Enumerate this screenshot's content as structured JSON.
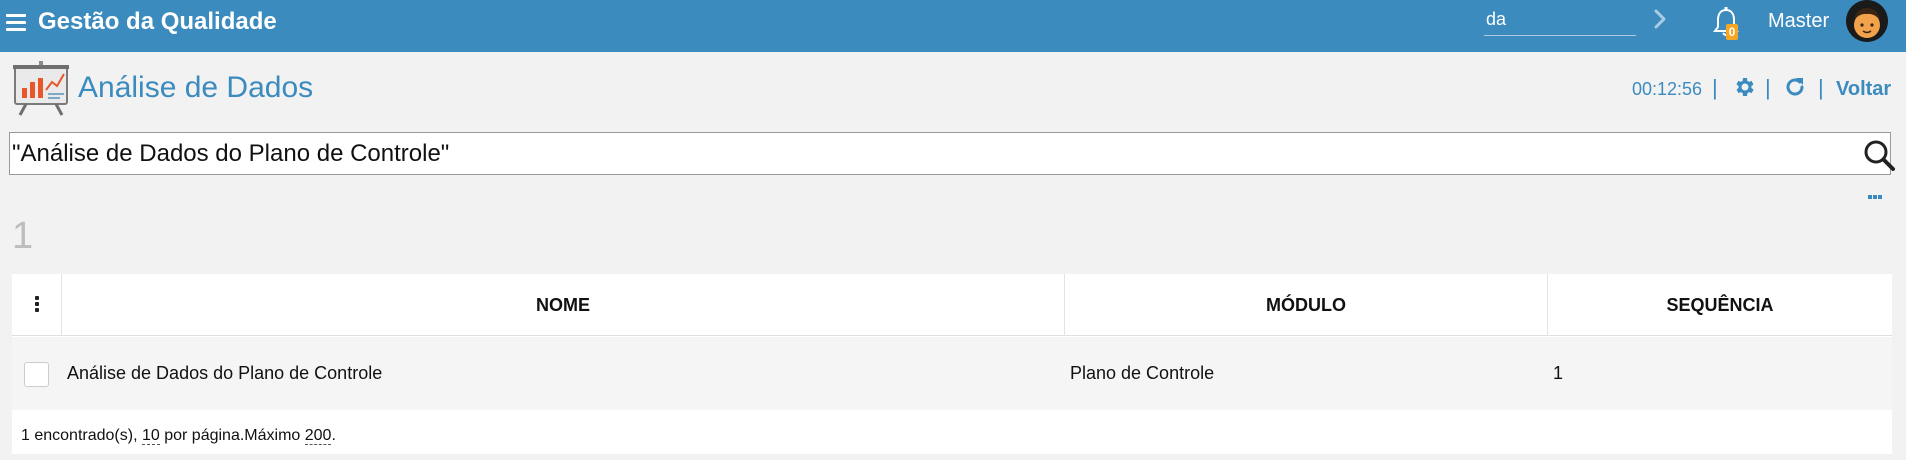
{
  "topbar": {
    "app_title": "Gestão da Qualidade",
    "search_value": "da",
    "notification_count": "0",
    "user_name": "Master"
  },
  "header": {
    "title": "Análise de Dados",
    "timer": "00:12:56",
    "separator": "|",
    "back_label": "Voltar"
  },
  "search": {
    "value": "\"Análise de Dados do Plano de Controle\""
  },
  "results": {
    "count": "1",
    "columns": [
      "NOME",
      "MÓDULO",
      "SEQUÊNCIA"
    ],
    "rows": [
      {
        "nome": "Análise de Dados do Plano de Controle",
        "modulo": "Plano de Controle",
        "sequencia": "1"
      }
    ],
    "footer": {
      "found_text": "1 encontrado(s),",
      "per_page": "10",
      "per_page_text": "por página.Máximo",
      "max": "200",
      "end": "."
    }
  },
  "colors": {
    "brand": "#3b8bbf",
    "badge": "#f5a623"
  },
  "icons": [
    "menu-icon",
    "chevron-right-icon",
    "bell-icon",
    "avatar",
    "presentation-chart-icon",
    "gear-icon",
    "refresh-icon",
    "search-icon",
    "more-icon",
    "column-menu-icon"
  ]
}
